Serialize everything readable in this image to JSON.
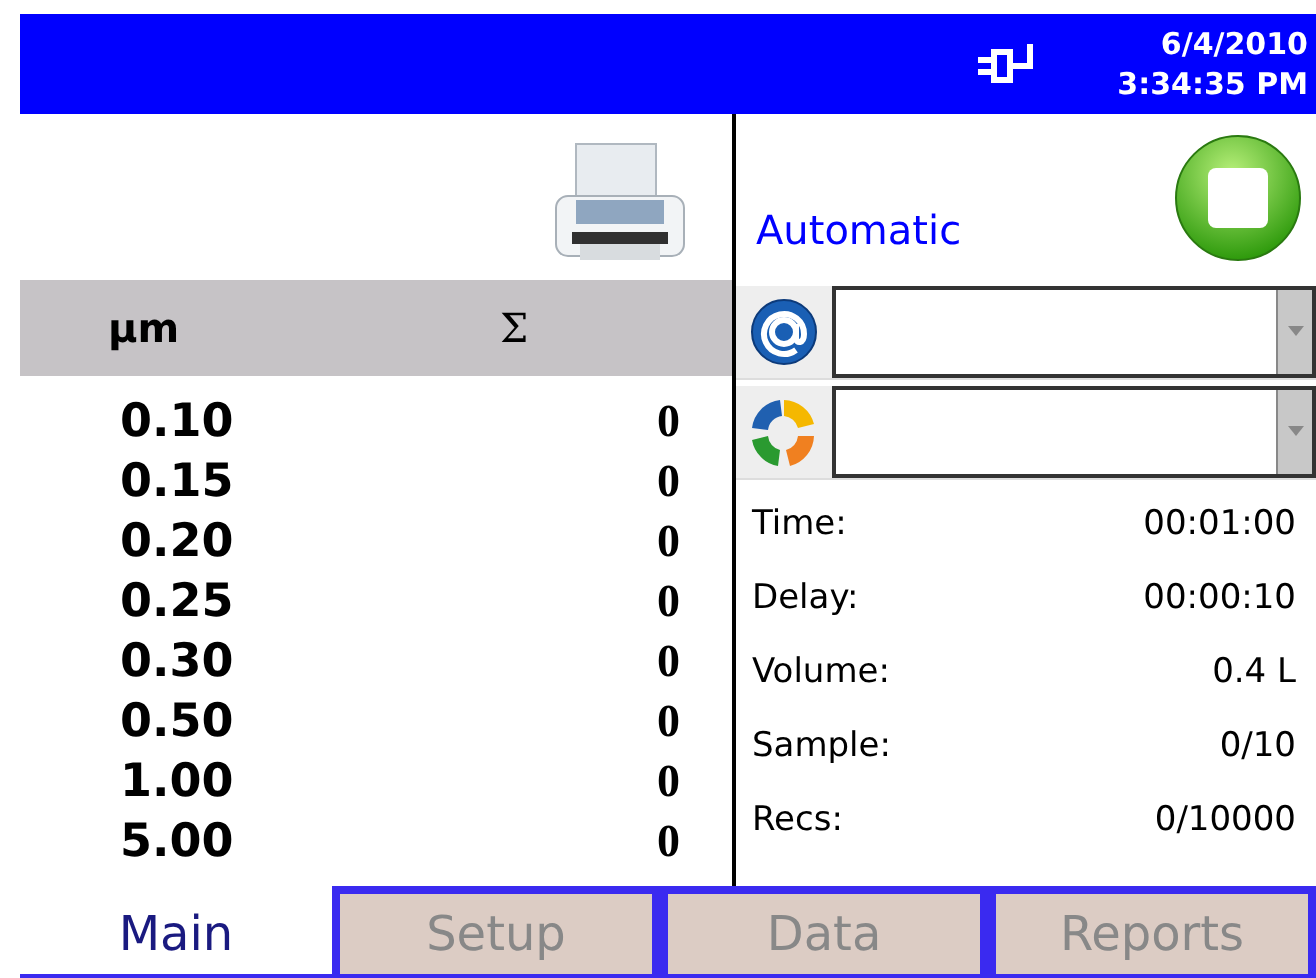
{
  "status_bar": {
    "date": "6/4/2010",
    "time": "3:34:35 PM"
  },
  "mode": "Automatic",
  "table": {
    "columns": [
      "µm",
      "Σ"
    ],
    "rows": [
      [
        "0.10",
        "0"
      ],
      [
        "0.15",
        "0"
      ],
      [
        "0.20",
        "0"
      ],
      [
        "0.25",
        "0"
      ],
      [
        "0.30",
        "0"
      ],
      [
        "0.50",
        "0"
      ],
      [
        "1.00",
        "0"
      ],
      [
        "5.00",
        "0"
      ]
    ]
  },
  "selectors": [
    {
      "kind": "email"
    },
    {
      "kind": "cycle"
    }
  ],
  "settings": [
    {
      "label": "Time:",
      "value": "00:01:00"
    },
    {
      "label": "Delay:",
      "value": "00:00:10"
    },
    {
      "label": "Volume:",
      "value": "0.4 L"
    },
    {
      "label": "Sample:",
      "value": "0/10"
    },
    {
      "label": "Recs:",
      "value": "0/10000"
    }
  ],
  "tabs": [
    {
      "label": "Main",
      "selected": true
    },
    {
      "label": "Setup",
      "selected": false
    },
    {
      "label": "Data",
      "selected": false
    },
    {
      "label": "Reports",
      "selected": false
    }
  ]
}
